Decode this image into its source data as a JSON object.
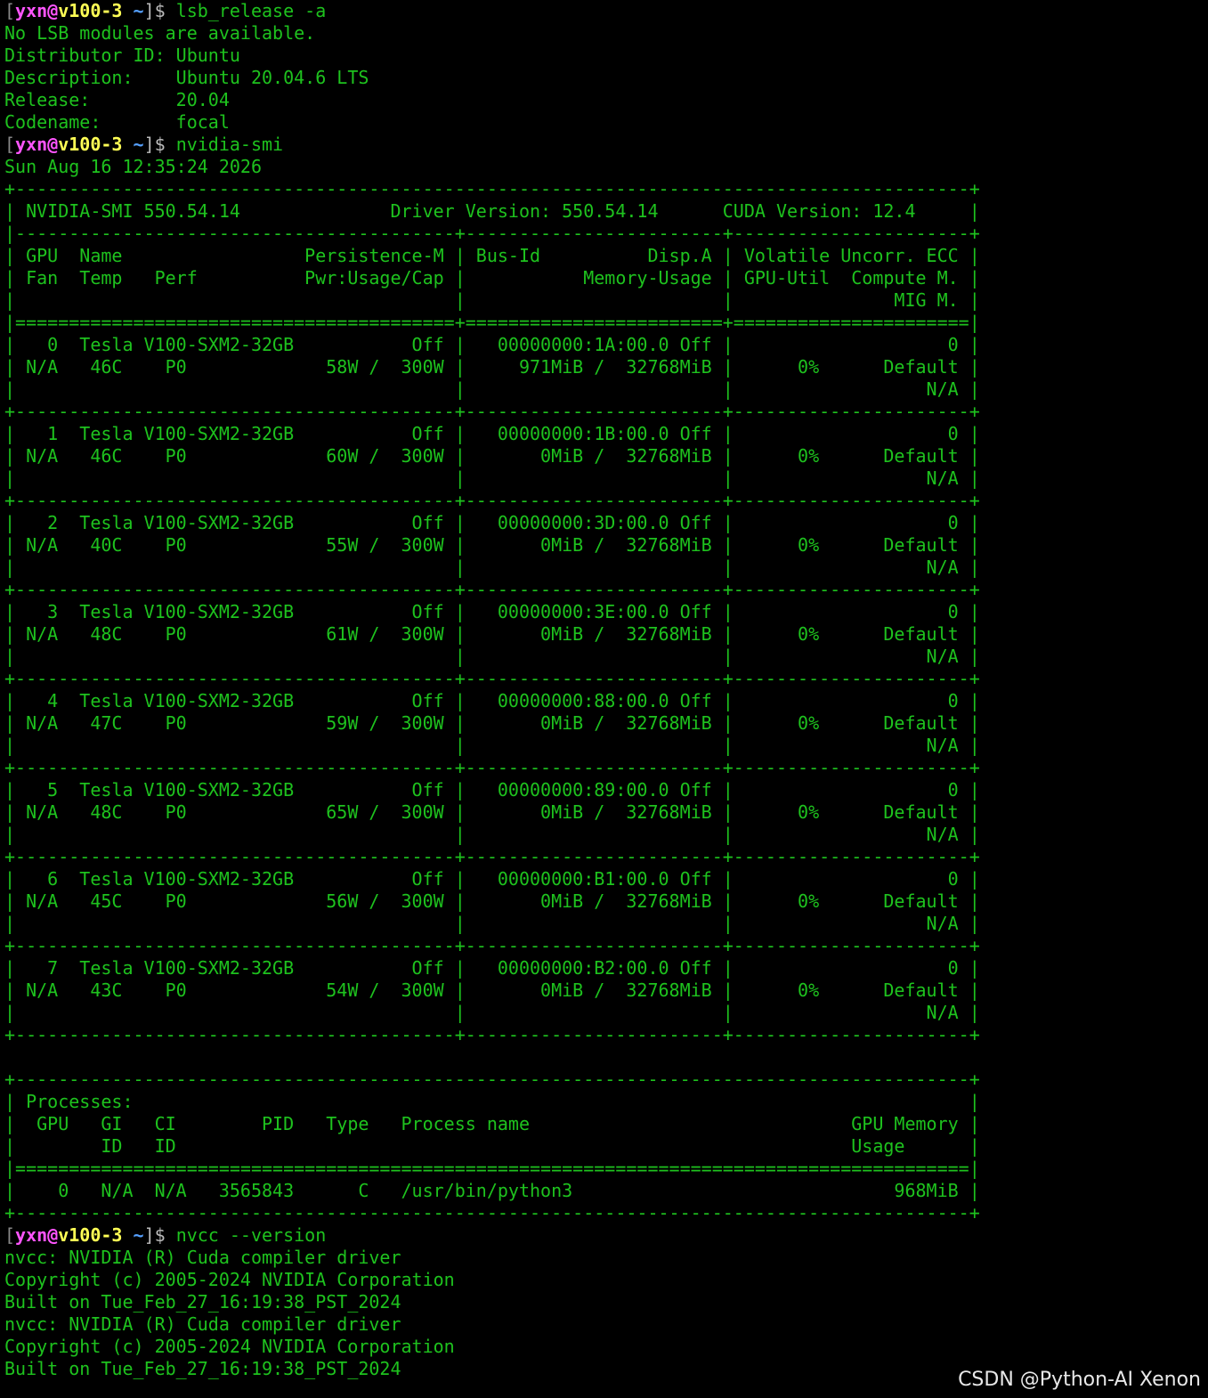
{
  "colors": {
    "background": "#000000",
    "output_text": "#1ec21e",
    "prompt_user": "#ff55ff",
    "prompt_host": "#ffff55",
    "prompt_tilde": "#55a0ff",
    "prompt_bracket": "#888888",
    "watermark": "#e8e8e8"
  },
  "prompt": {
    "open_bracket": "[",
    "user": "yxn",
    "at": "@",
    "host": "v100-3",
    "space": " ",
    "dir": "~",
    "close": "]$ "
  },
  "lines": [
    {
      "kind": "prompt",
      "cmd": "lsb_release -a"
    },
    {
      "kind": "out",
      "text": "No LSB modules are available."
    },
    {
      "kind": "out",
      "text": "Distributor ID: Ubuntu"
    },
    {
      "kind": "out",
      "text": "Description:    Ubuntu 20.04.6 LTS"
    },
    {
      "kind": "out",
      "text": "Release:        20.04"
    },
    {
      "kind": "out",
      "text": "Codename:       focal"
    },
    {
      "kind": "prompt",
      "cmd": "nvidia-smi"
    },
    {
      "kind": "out",
      "text": "Sun Aug 16 12:35:24 2026"
    },
    {
      "kind": "out",
      "text": "+-----------------------------------------------------------------------------------------+"
    },
    {
      "kind": "out",
      "text": "| NVIDIA-SMI 550.54.14              Driver Version: 550.54.14      CUDA Version: 12.4     |"
    },
    {
      "kind": "out",
      "text": "|-----------------------------------------+------------------------+----------------------+"
    },
    {
      "kind": "out",
      "text": "| GPU  Name                 Persistence-M | Bus-Id          Disp.A | Volatile Uncorr. ECC |"
    },
    {
      "kind": "out",
      "text": "| Fan  Temp   Perf          Pwr:Usage/Cap |           Memory-Usage | GPU-Util  Compute M. |"
    },
    {
      "kind": "out",
      "text": "|                                         |                        |               MIG M. |"
    },
    {
      "kind": "out",
      "text": "|=========================================+========================+======================|"
    },
    {
      "kind": "out",
      "text": "|   0  Tesla V100-SXM2-32GB           Off |   00000000:1A:00.0 Off |                    0 |"
    },
    {
      "kind": "out",
      "text": "| N/A   46C    P0             58W /  300W |     971MiB /  32768MiB |      0%      Default |"
    },
    {
      "kind": "out",
      "text": "|                                         |                        |                  N/A |"
    },
    {
      "kind": "out",
      "text": "+-----------------------------------------+------------------------+----------------------+"
    },
    {
      "kind": "out",
      "text": "|   1  Tesla V100-SXM2-32GB           Off |   00000000:1B:00.0 Off |                    0 |"
    },
    {
      "kind": "out",
      "text": "| N/A   46C    P0             60W /  300W |       0MiB /  32768MiB |      0%      Default |"
    },
    {
      "kind": "out",
      "text": "|                                         |                        |                  N/A |"
    },
    {
      "kind": "out",
      "text": "+-----------------------------------------+------------------------+----------------------+"
    },
    {
      "kind": "out",
      "text": "|   2  Tesla V100-SXM2-32GB           Off |   00000000:3D:00.0 Off |                    0 |"
    },
    {
      "kind": "out",
      "text": "| N/A   40C    P0             55W /  300W |       0MiB /  32768MiB |      0%      Default |"
    },
    {
      "kind": "out",
      "text": "|                                         |                        |                  N/A |"
    },
    {
      "kind": "out",
      "text": "+-----------------------------------------+------------------------+----------------------+"
    },
    {
      "kind": "out",
      "text": "|   3  Tesla V100-SXM2-32GB           Off |   00000000:3E:00.0 Off |                    0 |"
    },
    {
      "kind": "out",
      "text": "| N/A   48C    P0             61W /  300W |       0MiB /  32768MiB |      0%      Default |"
    },
    {
      "kind": "out",
      "text": "|                                         |                        |                  N/A |"
    },
    {
      "kind": "out",
      "text": "+-----------------------------------------+------------------------+----------------------+"
    },
    {
      "kind": "out",
      "text": "|   4  Tesla V100-SXM2-32GB           Off |   00000000:88:00.0 Off |                    0 |"
    },
    {
      "kind": "out",
      "text": "| N/A   47C    P0             59W /  300W |       0MiB /  32768MiB |      0%      Default |"
    },
    {
      "kind": "out",
      "text": "|                                         |                        |                  N/A |"
    },
    {
      "kind": "out",
      "text": "+-----------------------------------------+------------------------+----------------------+"
    },
    {
      "kind": "out",
      "text": "|   5  Tesla V100-SXM2-32GB           Off |   00000000:89:00.0 Off |                    0 |"
    },
    {
      "kind": "out",
      "text": "| N/A   48C    P0             65W /  300W |       0MiB /  32768MiB |      0%      Default |"
    },
    {
      "kind": "out",
      "text": "|                                         |                        |                  N/A |"
    },
    {
      "kind": "out",
      "text": "+-----------------------------------------+------------------------+----------------------+"
    },
    {
      "kind": "out",
      "text": "|   6  Tesla V100-SXM2-32GB           Off |   00000000:B1:00.0 Off |                    0 |"
    },
    {
      "kind": "out",
      "text": "| N/A   45C    P0             56W /  300W |       0MiB /  32768MiB |      0%      Default |"
    },
    {
      "kind": "out",
      "text": "|                                         |                        |                  N/A |"
    },
    {
      "kind": "out",
      "text": "+-----------------------------------------+------------------------+----------------------+"
    },
    {
      "kind": "out",
      "text": "|   7  Tesla V100-SXM2-32GB           Off |   00000000:B2:00.0 Off |                    0 |"
    },
    {
      "kind": "out",
      "text": "| N/A   43C    P0             54W /  300W |       0MiB /  32768MiB |      0%      Default |"
    },
    {
      "kind": "out",
      "text": "|                                         |                        |                  N/A |"
    },
    {
      "kind": "out",
      "text": "+-----------------------------------------+------------------------+----------------------+"
    },
    {
      "kind": "out",
      "text": ""
    },
    {
      "kind": "out",
      "text": "+-----------------------------------------------------------------------------------------+"
    },
    {
      "kind": "out",
      "text": "| Processes:                                                                              |"
    },
    {
      "kind": "out",
      "text": "|  GPU   GI   CI        PID   Type   Process name                              GPU Memory |"
    },
    {
      "kind": "out",
      "text": "|        ID   ID                                                               Usage      |"
    },
    {
      "kind": "out",
      "text": "|=========================================================================================|"
    },
    {
      "kind": "out",
      "text": "|    0   N/A  N/A   3565843      C   /usr/bin/python3                              968MiB |"
    },
    {
      "kind": "out",
      "text": "+-----------------------------------------------------------------------------------------+"
    },
    {
      "kind": "prompt",
      "cmd": "nvcc --version"
    },
    {
      "kind": "out",
      "text": "nvcc: NVIDIA (R) Cuda compiler driver"
    },
    {
      "kind": "out",
      "text": "Copyright (c) 2005-2024 NVIDIA Corporation"
    },
    {
      "kind": "out",
      "text": "Built on Tue_Feb_27_16:19:38_PST_2024"
    },
    {
      "kind": "out",
      "text": "nvcc: NVIDIA (R) Cuda compiler driver"
    },
    {
      "kind": "out",
      "text": "Copyright (c) 2005-2024 NVIDIA Corporation"
    },
    {
      "kind": "out",
      "text": "Built on Tue_Feb_27_16:19:38_PST_2024"
    }
  ],
  "watermark": "CSDN @Python-AI Xenon"
}
